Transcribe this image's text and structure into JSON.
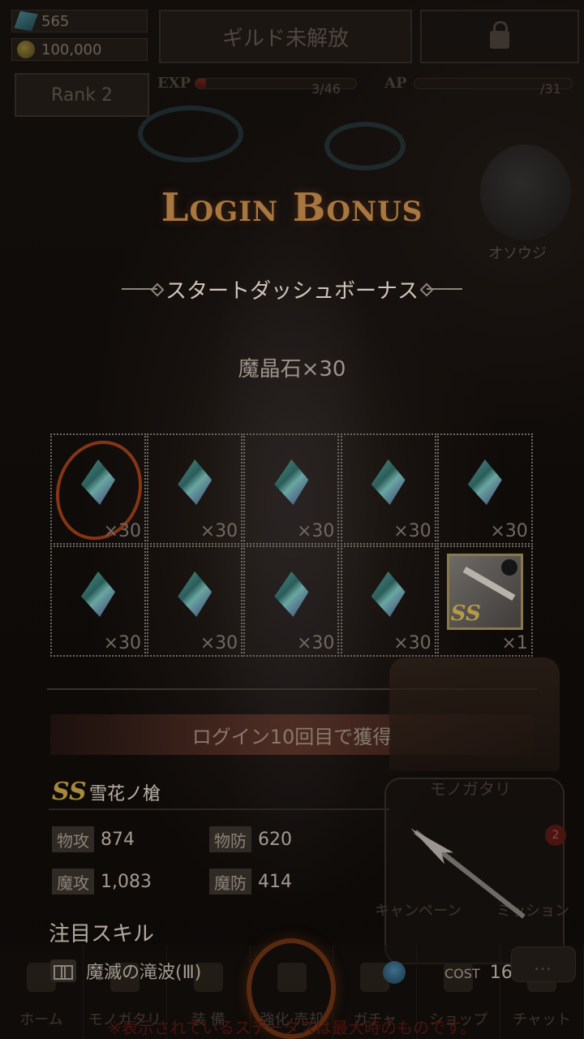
{
  "header": {
    "crystals": "565",
    "coins": "100,000",
    "guild_button": "ギルド未解放",
    "rank_button": "Rank 2",
    "exp": {
      "label": "EXP",
      "value": "3/46",
      "fill": 0.065
    },
    "ap": {
      "label": "AP",
      "value": "/31",
      "fill": 0.0
    }
  },
  "login_bonus": {
    "title": "Login Bonus",
    "subtitle": "スタートダッシュボーナス",
    "reward_label": "魔晶石×30",
    "days": [
      {
        "qty": "×30",
        "claimed": true,
        "icon": "crystal-icon"
      },
      {
        "qty": "×30",
        "claimed": false,
        "icon": "crystal-icon"
      },
      {
        "qty": "×30",
        "claimed": false,
        "icon": "crystal-icon"
      },
      {
        "qty": "×30",
        "claimed": false,
        "icon": "crystal-icon"
      },
      {
        "qty": "×30",
        "claimed": false,
        "icon": "crystal-icon"
      },
      {
        "qty": "×30",
        "claimed": false,
        "icon": "crystal-icon"
      },
      {
        "qty": "×30",
        "claimed": false,
        "icon": "crystal-icon"
      },
      {
        "qty": "×30",
        "claimed": false,
        "icon": "crystal-icon"
      },
      {
        "qty": "×30",
        "claimed": false,
        "icon": "crystal-icon"
      },
      {
        "qty": "×1",
        "claimed": false,
        "icon": "weapon-card",
        "rank": "SS"
      }
    ],
    "acquire_banner": "ログイン10回目で獲得"
  },
  "item": {
    "rank": "SS",
    "name": "雪花ノ槍",
    "stats": [
      {
        "key": "物攻",
        "value": "874"
      },
      {
        "key": "物防",
        "value": "620"
      },
      {
        "key": "魔攻",
        "value": "1,083"
      },
      {
        "key": "魔防",
        "value": "414"
      }
    ],
    "skill_title": "注目スキル",
    "skill_name": "魔滅の滝波(Ⅲ)",
    "cost_label": "COST",
    "cost_value": "16"
  },
  "side_panel": {
    "title": "モノガタリ",
    "badge": "2",
    "campaign": "キャンペーン",
    "mission": "ミッション",
    "cleaning": "オソウジ"
  },
  "chat_bubble": "…",
  "nav": [
    "ホーム",
    "モノガタリ",
    "装 備",
    "強化·売却",
    "ガチャ",
    "ショップ",
    "チャット"
  ],
  "footnote": "※表示されているステータスは最大時のものです。",
  "colors": {
    "accent": "#a8773f",
    "ss_gold": "#a6893e",
    "claimed_ring": "#9a3d16"
  }
}
